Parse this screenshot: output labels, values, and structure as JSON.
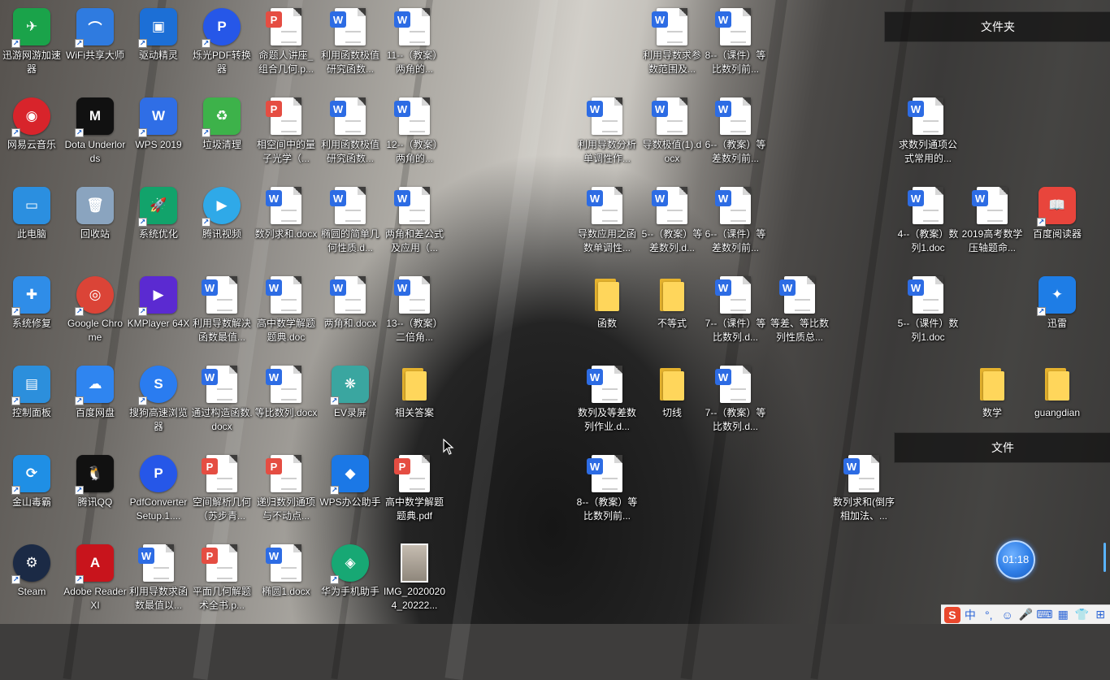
{
  "fences": [
    {
      "title": "文件夹"
    },
    {
      "title": "文件"
    }
  ],
  "icons": [
    {
      "label": "迅游网游加速器",
      "type": "app",
      "icon": "xunyou-icon",
      "color": "#1aa34a",
      "glyph": "✈",
      "shortcut": true
    },
    {
      "label": "WiFi共享大师",
      "type": "app",
      "icon": "wifi-icon",
      "color": "#2f7be0",
      "glyph": "⌒",
      "shortcut": true
    },
    {
      "label": "驱动精灵",
      "type": "app",
      "icon": "driver-icon",
      "color": "#1c6fd6",
      "glyph": "▣",
      "shortcut": true
    },
    {
      "label": "烁光PDF转换器",
      "type": "app",
      "icon": "pdf-converter-icon",
      "color": "#2657e8",
      "glyph": "P",
      "shortcut": true
    },
    {
      "label": "命题人讲座_组合几何.p...",
      "type": "pdf",
      "icon": "pdf-file-icon"
    },
    {
      "label": "利用函数极值研究函数...",
      "type": "word",
      "icon": "word-file-icon"
    },
    {
      "label": "11--（教案）两角的...",
      "type": "word",
      "icon": "word-file-icon"
    },
    {
      "label": "利用导数求参数范围及...",
      "type": "word",
      "icon": "word-file-icon"
    },
    {
      "label": "8--（课件）等比数列前...",
      "type": "word",
      "icon": "word-file-icon"
    },
    {
      "label": "网易云音乐",
      "type": "app",
      "icon": "netease-music-icon",
      "color": "#d8242b",
      "glyph": "◉",
      "shortcut": true
    },
    {
      "label": "Dota Underlords",
      "type": "app",
      "icon": "dota-icon",
      "color": "#111111",
      "glyph": "M",
      "shortcut": true
    },
    {
      "label": "WPS 2019",
      "type": "app",
      "icon": "wps-icon",
      "color": "#2f6ee6",
      "glyph": "W",
      "shortcut": true
    },
    {
      "label": "垃圾清理",
      "type": "app",
      "icon": "trash-cleaner-icon",
      "color": "#3db24a",
      "glyph": "♻",
      "shortcut": true
    },
    {
      "label": "相空间中的量子光学（...",
      "type": "pdf",
      "icon": "pdf-file-icon"
    },
    {
      "label": "利用函数极值研究函数...",
      "type": "word",
      "icon": "word-file-icon"
    },
    {
      "label": "12--（教案）两角的...",
      "type": "word",
      "icon": "word-file-icon"
    },
    {
      "label": "利用导数分析单调性作...",
      "type": "word",
      "icon": "word-file-icon"
    },
    {
      "label": "导数极值(1).docx",
      "type": "word",
      "icon": "word-file-icon"
    },
    {
      "label": "6--（教案）等差数列前...",
      "type": "word",
      "icon": "word-file-icon"
    },
    {
      "label": "求数列通项公式常用的...",
      "type": "word",
      "icon": "word-file-icon"
    },
    {
      "label": "此电脑",
      "type": "app",
      "icon": "computer-icon",
      "color": "#2b8fe0",
      "glyph": "▭",
      "shortcut": false
    },
    {
      "label": "回收站",
      "type": "app",
      "icon": "recycle-bin-icon",
      "color": "#8aa4bf",
      "glyph": "🗑",
      "shortcut": false
    },
    {
      "label": "系统优化",
      "type": "app",
      "icon": "system-optimize-icon",
      "color": "#12a36b",
      "glyph": "🚀",
      "shortcut": true
    },
    {
      "label": "腾讯视频",
      "type": "app",
      "icon": "tencent-video-icon",
      "color": "#2fa9e8",
      "glyph": "▶",
      "shortcut": true
    },
    {
      "label": "数列求和.docx",
      "type": "word",
      "icon": "word-file-icon"
    },
    {
      "label": "椭圆的简单几何性质.d...",
      "type": "word",
      "icon": "word-file-icon"
    },
    {
      "label": "两角和差公式及应用（...",
      "type": "word",
      "icon": "word-file-icon"
    },
    {
      "label": "导数应用之函数单调性...",
      "type": "word",
      "icon": "word-file-icon"
    },
    {
      "label": "5--（教案）等差数列.d...",
      "type": "word",
      "icon": "word-file-icon"
    },
    {
      "label": "6--（课件）等差数列前...",
      "type": "word",
      "icon": "word-file-icon"
    },
    {
      "label": "4--（教案）数列1.doc",
      "type": "word",
      "icon": "word-file-icon"
    },
    {
      "label": "2019高考数学压轴题命...",
      "type": "word",
      "icon": "word-file-icon"
    },
    {
      "label": "百度阅读器",
      "type": "app",
      "icon": "baidu-reader-icon",
      "color": "#e8453c",
      "glyph": "📖",
      "shortcut": true
    },
    {
      "label": "系统修复",
      "type": "app",
      "icon": "system-repair-icon",
      "color": "#2f8de8",
      "glyph": "✚",
      "shortcut": true
    },
    {
      "label": "Google Chrome",
      "type": "app",
      "icon": "chrome-icon",
      "color": "#db4437",
      "glyph": "◎",
      "shortcut": true
    },
    {
      "label": "KMPlayer 64X",
      "type": "app",
      "icon": "kmplayer-icon",
      "color": "#5b2ad1",
      "glyph": "▶",
      "shortcut": true
    },
    {
      "label": "利用导数解决函数最值...",
      "type": "word",
      "icon": "word-file-icon"
    },
    {
      "label": "高中数学解题题典.doc",
      "type": "word",
      "icon": "word-file-icon"
    },
    {
      "label": "两角和.docx",
      "type": "word",
      "icon": "word-file-icon"
    },
    {
      "label": "13--（教案）二倍角...",
      "type": "word",
      "icon": "word-file-icon"
    },
    {
      "label": "函数",
      "type": "folder",
      "icon": "folder-icon"
    },
    {
      "label": "不等式",
      "type": "folder",
      "icon": "folder-icon"
    },
    {
      "label": "7--（课件）等比数列.d...",
      "type": "word",
      "icon": "word-file-icon"
    },
    {
      "label": "等差、等比数列性质总...",
      "type": "word",
      "icon": "word-file-icon"
    },
    {
      "label": "5--（课件）数列1.doc",
      "type": "word",
      "icon": "word-file-icon"
    },
    {
      "label": "迅雷",
      "type": "app",
      "icon": "thunder-icon",
      "color": "#1e7de6",
      "glyph": "✦",
      "shortcut": true
    },
    {
      "label": "控制面板",
      "type": "app",
      "icon": "control-panel-icon",
      "color": "#2c8fdc",
      "glyph": "▤",
      "shortcut": true
    },
    {
      "label": "百度网盘",
      "type": "app",
      "icon": "baidu-netdisk-icon",
      "color": "#2f85f0",
      "glyph": "☁",
      "shortcut": true
    },
    {
      "label": "搜狗高速浏览器",
      "type": "app",
      "icon": "sogou-browser-icon",
      "color": "#2a7cf0",
      "glyph": "S",
      "shortcut": true
    },
    {
      "label": "通过构造函数.docx",
      "type": "word",
      "icon": "word-file-icon"
    },
    {
      "label": "等比数列.docx",
      "type": "word",
      "icon": "word-file-icon"
    },
    {
      "label": "EV录屏",
      "type": "app",
      "icon": "ev-recorder-icon",
      "color": "#3aa6a0",
      "glyph": "❋",
      "shortcut": true
    },
    {
      "label": "相关答案",
      "type": "folder",
      "icon": "folder-icon"
    },
    {
      "label": "数列及等差数列作业.d...",
      "type": "word",
      "icon": "word-file-icon"
    },
    {
      "label": "切线",
      "type": "folder",
      "icon": "folder-icon"
    },
    {
      "label": "7--（教案）等比数列.d...",
      "type": "word",
      "icon": "word-file-icon"
    },
    {
      "label": "数学",
      "type": "folder",
      "icon": "folder-icon"
    },
    {
      "label": "guangdian",
      "type": "folder",
      "icon": "folder-icon"
    },
    {
      "label": "金山毒霸",
      "type": "app",
      "icon": "kingsoft-antivirus-icon",
      "color": "#1f8fe5",
      "glyph": "⟳",
      "shortcut": true
    },
    {
      "label": "腾讯QQ",
      "type": "app",
      "icon": "qq-icon",
      "color": "#111111",
      "glyph": "🐧",
      "shortcut": true
    },
    {
      "label": "PdfConverterSetup.1....",
      "type": "app",
      "icon": "pdf-setup-icon",
      "color": "#2657e8",
      "glyph": "P",
      "shortcut": false
    },
    {
      "label": "空间解析几何（苏步青...",
      "type": "pdf",
      "icon": "pdf-file-icon"
    },
    {
      "label": "递归数列通项与不动点...",
      "type": "pdf",
      "icon": "pdf-file-icon"
    },
    {
      "label": "WPS办公助手",
      "type": "app",
      "icon": "wps-assistant-icon",
      "color": "#1b78e6",
      "glyph": "◆",
      "shortcut": true
    },
    {
      "label": "高中数学解题题典.pdf",
      "type": "pdf",
      "icon": "pdf-file-icon"
    },
    {
      "label": "8--（教案）等比数列前...",
      "type": "word",
      "icon": "word-file-icon"
    },
    {
      "label": "数列求和(倒序相加法、...",
      "type": "word",
      "icon": "word-file-icon"
    },
    {
      "label": "Steam",
      "type": "app",
      "icon": "steam-icon",
      "color": "#1b2a45",
      "glyph": "⚙",
      "shortcut": true
    },
    {
      "label": "Adobe Reader XI",
      "type": "app",
      "icon": "adobe-reader-icon",
      "color": "#c8141c",
      "glyph": "A",
      "shortcut": true
    },
    {
      "label": "利用导数求函数最值以...",
      "type": "word",
      "icon": "word-file-icon"
    },
    {
      "label": "平面几何解题术全书.p...",
      "type": "pdf",
      "icon": "pdf-file-icon"
    },
    {
      "label": "椭圆1.docx",
      "type": "word",
      "icon": "word-file-icon"
    },
    {
      "label": "华为手机助手",
      "type": "app",
      "icon": "huawei-assistant-icon",
      "color": "#17a874",
      "glyph": "◈",
      "shortcut": true
    },
    {
      "label": "IMG_20200204_20222...",
      "type": "image",
      "icon": "image-file-icon"
    }
  ],
  "clock": {
    "time": "01:18"
  },
  "tray": [
    {
      "name": "sogou-ime-icon",
      "glyph": "S"
    },
    {
      "name": "chinese-mode-icon",
      "glyph": "中"
    },
    {
      "name": "punctuation-icon",
      "glyph": "°,"
    },
    {
      "name": "emoji-icon",
      "glyph": "☺"
    },
    {
      "name": "microphone-icon",
      "glyph": "🎤"
    },
    {
      "name": "keyboard-icon",
      "glyph": "⌨"
    },
    {
      "name": "toolbox-icon",
      "glyph": "▦"
    },
    {
      "name": "skin-icon",
      "glyph": "👕"
    },
    {
      "name": "grid-menu-icon",
      "glyph": "⊞"
    }
  ]
}
